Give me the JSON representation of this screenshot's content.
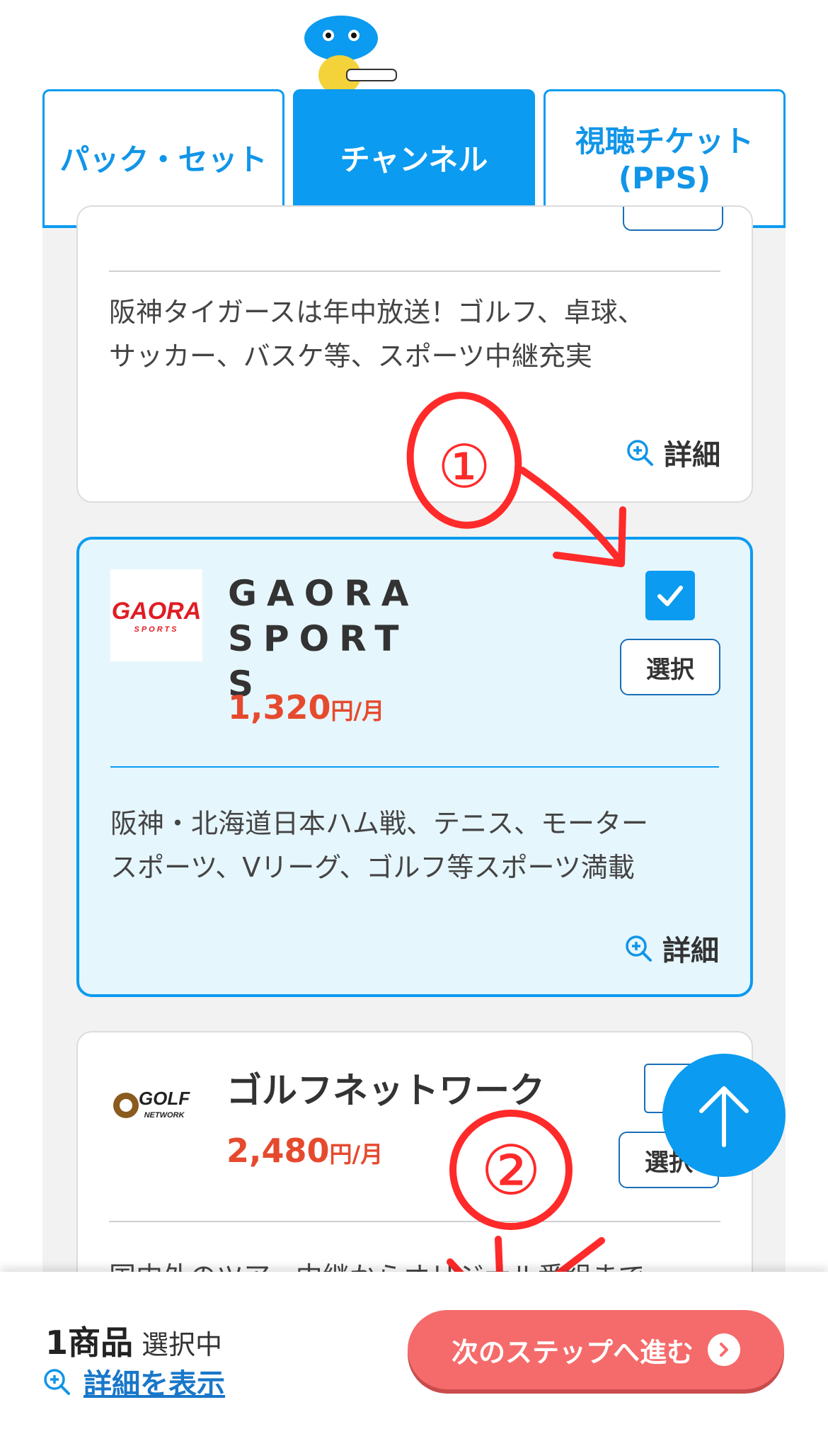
{
  "tabs": [
    {
      "label": "パック・セット",
      "active": false
    },
    {
      "label": "チャンネル",
      "active": true
    },
    {
      "label_line1": "視聴チケット",
      "label_line2": "(PPS)",
      "active": false
    }
  ],
  "cards": [
    {
      "description_line1": "阪神タイガースは年中放送！ゴルフ、卓球、",
      "description_line2": "サッカー、バスケ等、スポーツ中継充実",
      "detail_label": "詳細"
    },
    {
      "logo_text": "GAORA",
      "logo_subtext": "SPORTS",
      "name_line1": "GAORA　SPORT",
      "name_line2": "S",
      "price": "1,320",
      "price_unit": "円/月",
      "selected": true,
      "select_label": "選択",
      "description_line1": "阪神・北海道日本ハム戦、テニス、モーター",
      "description_line2": "スポーツ、Vリーグ、ゴルフ等スポーツ満載",
      "detail_label": "詳細"
    },
    {
      "logo_text": "GOLF",
      "logo_subtext": "NETWORK",
      "name": "ゴルフネットワーク",
      "price": "2,480",
      "price_unit": "円/月",
      "selected": false,
      "select_label": "選択",
      "description_partial": "国内外のツアー中継からオリジナル番組まで"
    }
  ],
  "footer": {
    "count": "1商品",
    "count_suffix": "選択中",
    "show_detail_label": "詳細を表示",
    "next_button_label": "次のステップへ進む"
  },
  "annotations": [
    "①",
    "②"
  ],
  "colors": {
    "accent": "#0b9bf0",
    "price": "#e64a2e",
    "next_button": "#f56b6b",
    "annotation": "#ff2a2a"
  }
}
